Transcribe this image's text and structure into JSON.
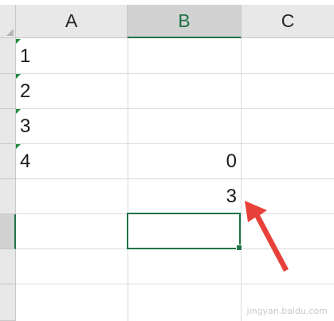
{
  "columns": [
    {
      "label": "A"
    },
    {
      "label": "B"
    },
    {
      "label": "C"
    }
  ],
  "cells": {
    "A1": "1",
    "A2": "2",
    "A3": "3",
    "A4": "4",
    "B4": "0",
    "B5": "3"
  },
  "active_cell": "B6",
  "colors": {
    "accent": "#217346",
    "header_bg": "#e8e8e8",
    "arrow": "#e8413a",
    "error_flag": "#1e8a3c"
  }
}
